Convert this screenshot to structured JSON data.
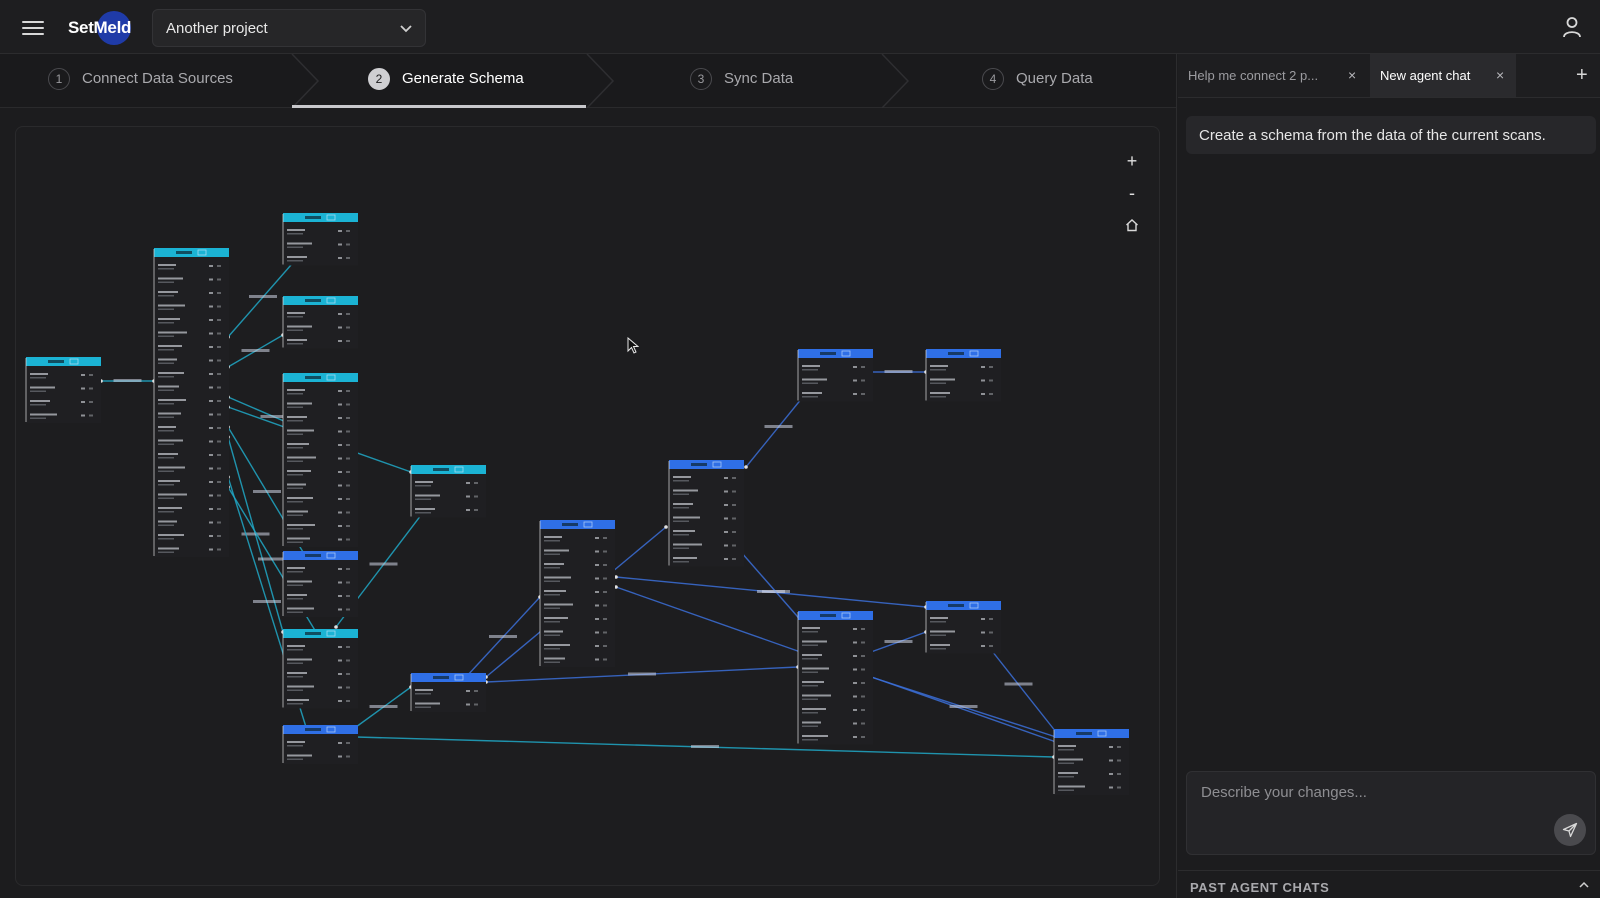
{
  "app": {
    "logo_text": "SetMeld"
  },
  "project_selector": {
    "value": "Another project"
  },
  "steps": [
    {
      "num": "1",
      "label": "Connect Data Sources"
    },
    {
      "num": "2",
      "label": "Generate Schema",
      "active": true
    },
    {
      "num": "3",
      "label": "Sync Data"
    },
    {
      "num": "4",
      "label": "Query Data"
    }
  ],
  "canvas_controls": {
    "zoom_in": "+",
    "zoom_out": "-",
    "home_icon": "home-icon"
  },
  "chat_tabs": [
    {
      "label": "Help me connect 2 p...",
      "close": "×"
    },
    {
      "label": "New agent chat",
      "close": "×",
      "active": true
    }
  ],
  "new_tab_label": "+",
  "messages": [
    "Create a schema from the data of the current scans."
  ],
  "composer": {
    "placeholder": "Describe your changes..."
  },
  "past_chats": {
    "label": "PAST AGENT CHATS"
  },
  "colors": {
    "teal_header": "#1bb3d4",
    "blue_header": "#2f6fe6",
    "accent_brand": "#1f3ba8"
  }
}
